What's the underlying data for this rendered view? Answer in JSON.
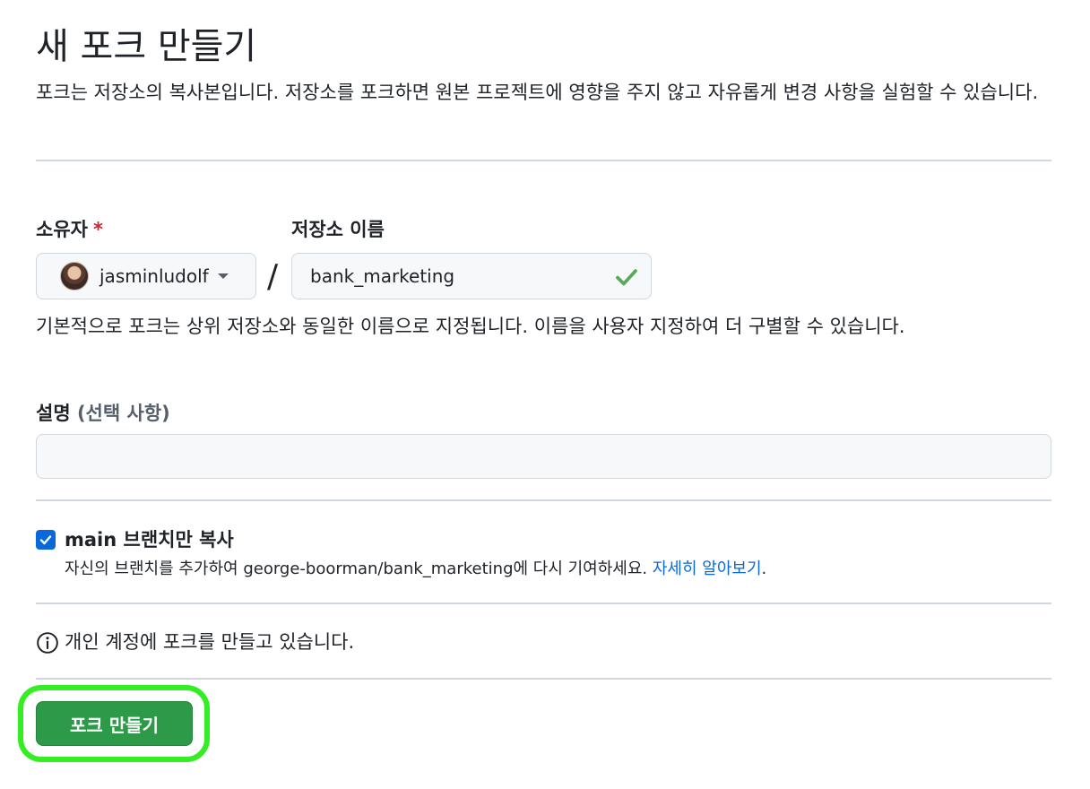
{
  "page": {
    "title": "새 포크 만들기",
    "subtitle": "포크는 저장소의 복사본입니다. 저장소를 포크하면 원본 프로젝트에 영향을 주지 않고 자유롭게 변경 사항을 실험할 수 있습니다."
  },
  "owner": {
    "label": "소유자",
    "required_mark": "*",
    "value": "jasminludolf",
    "separator": "/"
  },
  "repo_name": {
    "label": "저장소 이름",
    "value": "bank_marketing",
    "help": "기본적으로 포크는 상위 저장소와 동일한 이름으로 지정됩니다. 이름을 사용자 지정하여 더 구별할 수 있습니다."
  },
  "description": {
    "label": "설명",
    "optional": "(선택 사항)",
    "value": ""
  },
  "copy_branch": {
    "checked": true,
    "label": "main 브랜치만 복사",
    "note": "자신의 브랜치를 추가하여 george-boorman/bank_marketing에 다시 기여하세요.",
    "link": "자세히 알아보기",
    "period": "."
  },
  "info": {
    "text": "개인 계정에 포크를 만들고 있습니다."
  },
  "actions": {
    "create_label": "포크 만들기"
  },
  "colors": {
    "accent_blue": "#0969da",
    "primary_green": "#2c9a48",
    "highlight_green": "#33ee22",
    "valid_check": "#57ab5a",
    "required_red": "#cf222e"
  },
  "icons": {
    "check": "check-icon",
    "caret": "chevron-down-icon",
    "info": "info-icon",
    "checkbox": "checkbox-checked-icon"
  }
}
